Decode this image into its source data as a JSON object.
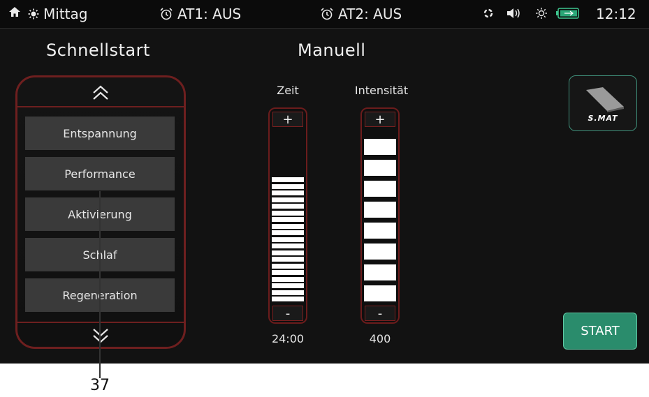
{
  "status_bar": {
    "daytime": "Mittag",
    "alarm1": "AT1: AUS",
    "alarm2": "AT2: AUS",
    "time": "12:12"
  },
  "quickstart": {
    "title": "Schnellstart",
    "items": [
      "Entspannung",
      "Performance",
      "Aktivierung",
      "Schlaf",
      "Regeneration"
    ]
  },
  "manual": {
    "title": "Manuell",
    "time": {
      "label": "Zeit",
      "value": "24:00",
      "plus": "+",
      "minus": "-",
      "filled_segments": 19
    },
    "intensity": {
      "label": "Intensität",
      "value": "400",
      "plus": "+",
      "minus": "-",
      "filled_segments": 8
    }
  },
  "device_button": {
    "label": "S.MAT"
  },
  "start_button": {
    "label": "START"
  },
  "callout": {
    "number": "37"
  },
  "colors": {
    "accent_red": "#6e1f1f",
    "start_green": "#2a8c6c",
    "device_border": "#3f8f7a"
  }
}
